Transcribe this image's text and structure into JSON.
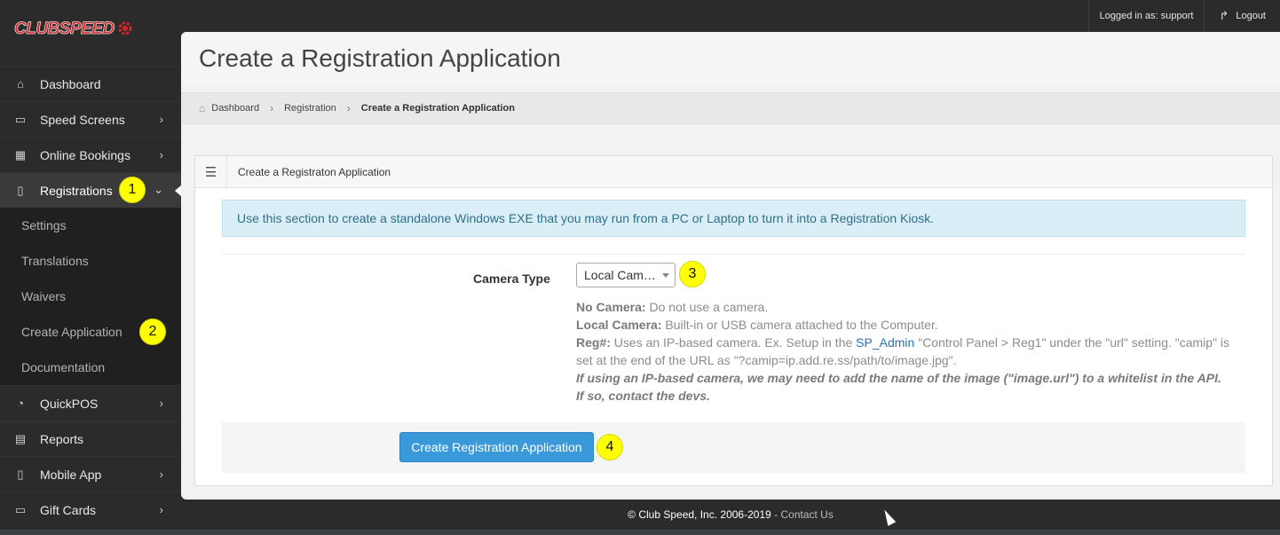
{
  "app": {
    "logo_text": "CLUBSPEED"
  },
  "topbar": {
    "logged_in": "Logged in as: support",
    "logout": "Logout"
  },
  "sidebar": {
    "items": [
      {
        "label": "Dashboard",
        "icon": "home-icon"
      },
      {
        "label": "Speed Screens",
        "icon": "monitor-icon",
        "has_children": true
      },
      {
        "label": "Online Bookings",
        "icon": "calendar-icon",
        "has_children": true
      },
      {
        "label": "Registrations",
        "icon": "tablet-icon",
        "has_children": true,
        "expanded": true
      },
      {
        "label": "QuickPOS",
        "icon": "speedometer-icon",
        "has_children": true
      },
      {
        "label": "Reports",
        "icon": "document-icon"
      },
      {
        "label": "Mobile App",
        "icon": "mobile-icon",
        "has_children": true
      },
      {
        "label": "Gift Cards",
        "icon": "credit-card-icon",
        "has_children": true
      }
    ],
    "sub_items": [
      "Settings",
      "Translations",
      "Waivers",
      "Create Application",
      "Documentation"
    ]
  },
  "badges": [
    "1",
    "2",
    "3",
    "4"
  ],
  "page": {
    "title": "Create a Registration Application",
    "breadcrumb": [
      "Dashboard",
      "Registration",
      "Create a Registration Application"
    ]
  },
  "panel": {
    "title": "Create a Registraton Application",
    "alert": "Use this section to create a standalone Windows EXE that you may run from a PC or Laptop to turn it into a Registration Kiosk.",
    "camera_label": "Camera Type",
    "camera_value": "Local Cam…",
    "help": {
      "no_camera_label": "No Camera:",
      "no_camera_text": " Do not use a camera.",
      "local_camera_label": "Local Camera:",
      "local_camera_text": " Built-in or USB camera attached to the Computer.",
      "reg_label": "Reg#:",
      "reg_text_1": " Uses an IP-based camera. Ex. Setup in the ",
      "reg_link": "SP_Admin",
      "reg_text_2": " \"Control Panel > Reg1\" under the \"url\" setting. \"camip\" is set at the end of the URL as \"?camip=ip.add.re.ss/path/to/image.jpg\".",
      "warning_1": "If using an IP-based camera, we may need to add the name of the image (\"image.url\") to a whitelist in the API.",
      "warning_2": "If so, contact the devs."
    },
    "submit_label": "Create Registration Application"
  },
  "footer": {
    "copyright": "© Club Speed, Inc.",
    "years": "2006-2019",
    "dash": "-",
    "contact": "Contact Us"
  },
  "colors": {
    "accent": "#3a9ad9",
    "sidebar_bg": "#2b2b2b",
    "badge": "#ffff00",
    "logo_red": "#d2262a"
  }
}
